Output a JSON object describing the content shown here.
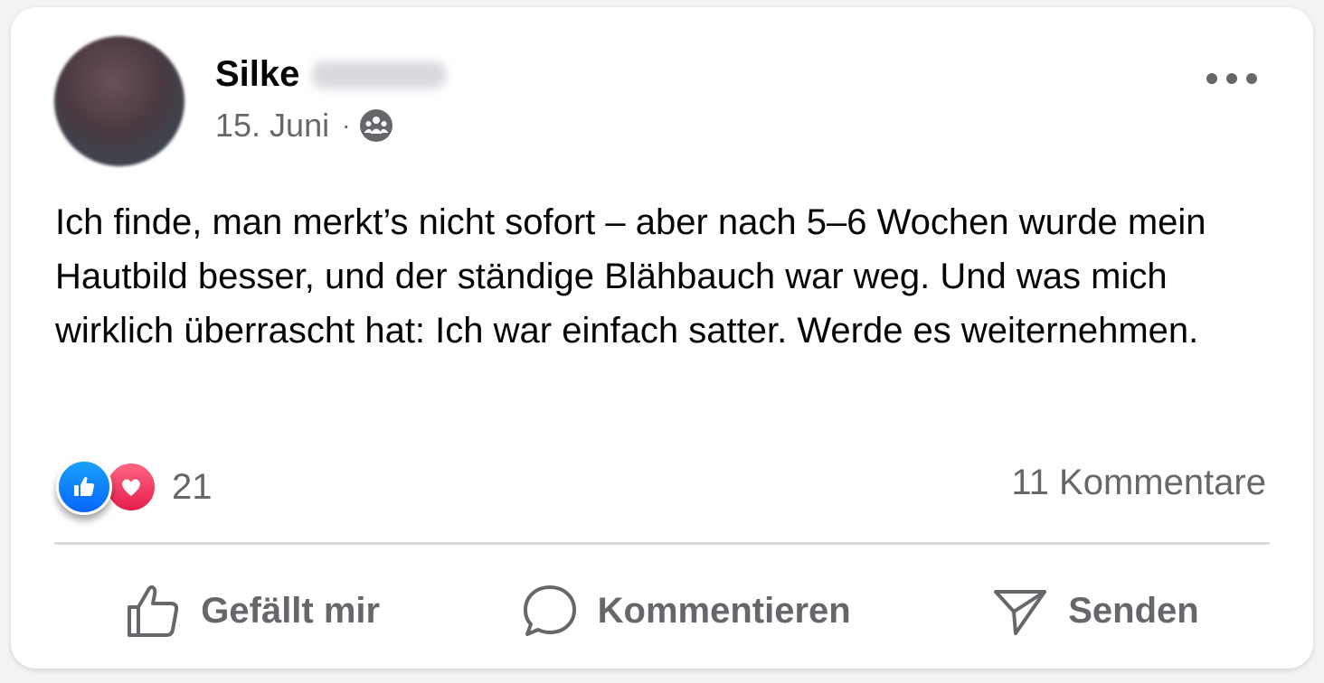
{
  "post": {
    "author_first_name": "Silke",
    "date": "15. Juni",
    "separator": "·",
    "audience_icon": "group-icon",
    "text": "Ich finde, man merkt’s nicht sofort – aber nach 5–6 Wochen wurde mein Hautbild besser, und der ständige Blähbauch war weg. Und was mich wirklich überrascht hat: Ich war einfach satter. Werde es weiternehmen.",
    "reaction_icons": [
      "like-icon",
      "love-icon"
    ],
    "reaction_count": "21",
    "comments_label": "11 Kommentare"
  },
  "actions": {
    "like_label": "Gefällt mir",
    "comment_label": "Kommentieren",
    "share_label": "Senden"
  },
  "colors": {
    "text_primary": "#050505",
    "text_secondary": "#65676b",
    "like_blue": "#0866ff",
    "love_red": "#e61e4d",
    "divider": "#d9dadd"
  }
}
